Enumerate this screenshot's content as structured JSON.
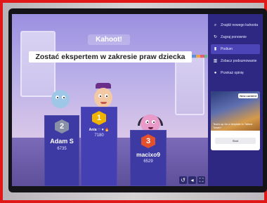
{
  "game": {
    "logo": "Kahoot!",
    "title": "Zostać ekspertem w zakresie praw dziecka"
  },
  "podium": [
    {
      "rank": "2",
      "name": "Adam S",
      "score": "6735",
      "badge_color": "#8a8fa8"
    },
    {
      "rank": "1",
      "name": "Ania ♡ ♥ 🔥",
      "score": "7180",
      "badge_color": "#f0b400"
    },
    {
      "rank": "3",
      "name": "macixo9",
      "score": "6529",
      "badge_color": "#e2502c"
    }
  ],
  "sidebar": {
    "items": [
      {
        "label": "Znajdź nowego kahoota",
        "icon": "search-icon"
      },
      {
        "label": "Zagraj ponownie",
        "icon": "replay-icon"
      },
      {
        "label": "Podium",
        "icon": "podium-icon",
        "active": true
      },
      {
        "label": "Zobacz podsumowanie",
        "icon": "chart-icon"
      },
      {
        "label": "Przekaż opinię",
        "icon": "chat-icon"
      }
    ],
    "promo": {
      "badge": "New content",
      "text": "Team up for a fairytale in Tallest Tower!",
      "button": "Start"
    }
  },
  "colors": {
    "frame_border": "#e01818",
    "sidebar_bg": "#2e2882",
    "podium_bg": "#3d3aa3"
  }
}
